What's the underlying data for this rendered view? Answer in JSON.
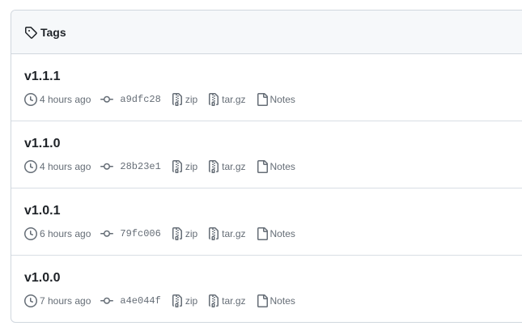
{
  "header": {
    "title": "Tags"
  },
  "tags": [
    {
      "name": "v1.1.1",
      "time": "4 hours ago",
      "sha": "a9dfc28",
      "zip": "zip",
      "targz": "tar.gz",
      "notes": "Notes"
    },
    {
      "name": "v1.1.0",
      "time": "4 hours ago",
      "sha": "28b23e1",
      "zip": "zip",
      "targz": "tar.gz",
      "notes": "Notes"
    },
    {
      "name": "v1.0.1",
      "time": "6 hours ago",
      "sha": "79fc006",
      "zip": "zip",
      "targz": "tar.gz",
      "notes": "Notes"
    },
    {
      "name": "v1.0.0",
      "time": "7 hours ago",
      "sha": "a4e044f",
      "zip": "zip",
      "targz": "tar.gz",
      "notes": "Notes"
    }
  ],
  "colors": {
    "text": "#1f2328",
    "muted": "#656d76",
    "border": "#d0d7de",
    "header_bg": "#f6f8fa"
  }
}
